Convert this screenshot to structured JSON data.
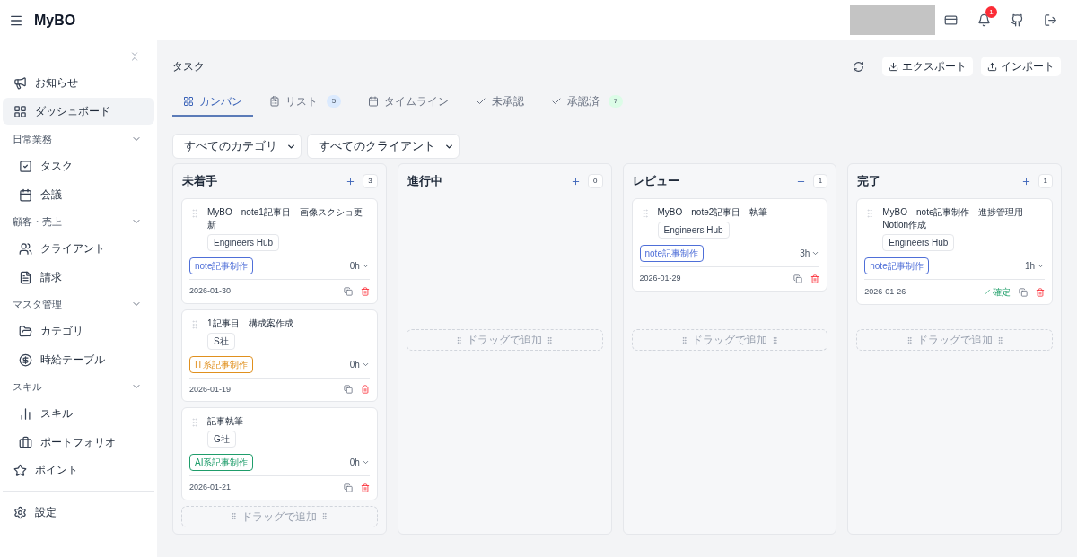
{
  "app": {
    "title": "MyBO"
  },
  "header": {
    "notification_count": "1"
  },
  "sidebar": {
    "items": [
      {
        "kind": "item",
        "label": "お知らせ",
        "selected": false
      },
      {
        "kind": "item",
        "label": "ダッシュボード",
        "selected": true
      },
      {
        "kind": "section",
        "label": "日常業務",
        "expanded": true,
        "children": [
          {
            "label": "タスク",
            "selected": false
          },
          {
            "label": "会議",
            "selected": false
          }
        ]
      },
      {
        "kind": "section",
        "label": "顧客・売上",
        "expanded": true,
        "children": [
          {
            "label": "クライアント",
            "selected": false
          },
          {
            "label": "請求",
            "selected": false
          }
        ]
      },
      {
        "kind": "section",
        "label": "マスタ管理",
        "expanded": true,
        "children": [
          {
            "label": "カテゴリ",
            "selected": false
          },
          {
            "label": "時給テーブル",
            "selected": false
          }
        ]
      },
      {
        "kind": "section",
        "label": "スキル",
        "expanded": true,
        "children": [
          {
            "label": "スキル",
            "selected": false
          },
          {
            "label": "ポートフォリオ",
            "selected": false
          }
        ]
      },
      {
        "kind": "item",
        "label": "ポイント",
        "selected": false
      }
    ],
    "footer": {
      "label": "設定"
    }
  },
  "page": {
    "title": "タスク",
    "actions": [
      "エクスポート",
      "インポート"
    ]
  },
  "tabs": [
    {
      "label": "カンバン",
      "selected": true
    },
    {
      "label": "リスト",
      "selected": false,
      "count": "5",
      "color": "#dbeafe"
    },
    {
      "label": "タイムライン",
      "selected": false
    },
    {
      "label": "未承認",
      "selected": false
    },
    {
      "label": "承認済",
      "selected": false,
      "count": "7",
      "color": "#dcfce7"
    }
  ],
  "filters": [
    "すべてのカテゴリ",
    "すべてのクライアント"
  ],
  "columns": [
    {
      "title": "未着手",
      "count": "3",
      "drop_label": "ドラッグで追加",
      "cards": [
        {
          "title": "MyBO　note1記事目　画像スクショ更新",
          "client": "Engineers Hub",
          "tag": "note記事制作",
          "color": "#4f6fd8",
          "hours": "0h",
          "date": "2026-01-30"
        },
        {
          "title": "1記事目　構成案作成",
          "client": "S社",
          "tag": "IT系記事制作",
          "color": "#e0901e",
          "hours": "0h",
          "date": "2026-01-19"
        },
        {
          "title": "記事執筆",
          "client": "G社",
          "tag": "AI系記事制作",
          "color": "#1f9d6b",
          "hours": "0h",
          "date": "2026-01-21"
        }
      ]
    },
    {
      "title": "進行中",
      "count": "0",
      "drop_label": "ドラッグで追加"
    },
    {
      "title": "レビュー",
      "count": "1",
      "drop_label": "ドラッグで追加",
      "cards": [
        {
          "title": "MyBO　note2記事目　執筆",
          "client": "Engineers Hub",
          "tag": "note記事制作",
          "color": "#4f6fd8",
          "hours": "3h",
          "date": "2026-01-29"
        }
      ]
    },
    {
      "title": "完了",
      "count": "1",
      "drop_label": "ドラッグで追加",
      "cards": [
        {
          "title": "MyBO　note記事制作　進捗管理用Notion作成",
          "client": "Engineers Hub",
          "tag": "note記事制作",
          "color": "#4f6fd8",
          "hours": "1h",
          "date": "2026-01-26",
          "status": "確定"
        }
      ]
    }
  ]
}
